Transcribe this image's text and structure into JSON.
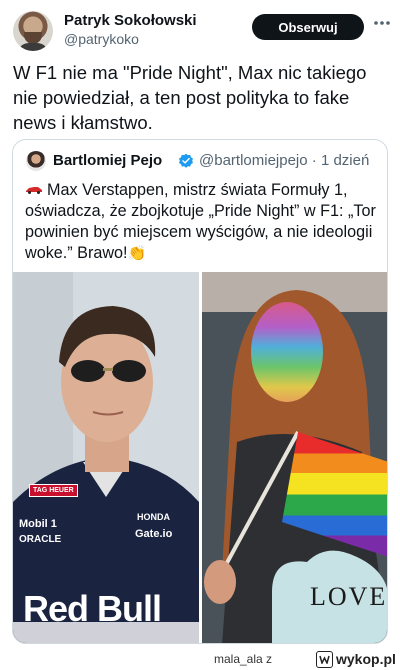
{
  "tweet": {
    "author_name": "Patryk Sokołowski",
    "author_handle": "@patrykoko",
    "follow_label": "Obserwuj",
    "text": "W F1 nie ma \"Pride Night\", Max nic takiego nie powiedział, a ten post polityka to fake news i kłamstwo."
  },
  "quoted": {
    "author_name": "Bartlomiej Pejo",
    "meta": "@bartlomiejpejo · 1 dzień",
    "text": "Max Verstappen, mistrz świata Formuły 1, oświadcza, że zbojkotuje „Pride Night” w F1: „Tor powinien być miejscem wyścigów, a nie ideologii woke.” Brawo!",
    "verified_color": "#1d9bf0",
    "images": [
      {
        "sponsor_lines": [
          "TAG HEUER",
          "Mobil 1",
          "ORACLE",
          "HONDA",
          "Gate.io",
          "Red Bull"
        ]
      },
      {
        "sign_text": "LOVE"
      }
    ]
  },
  "watermark": {
    "user": "mala_ala z",
    "site": "wykop.pl"
  }
}
